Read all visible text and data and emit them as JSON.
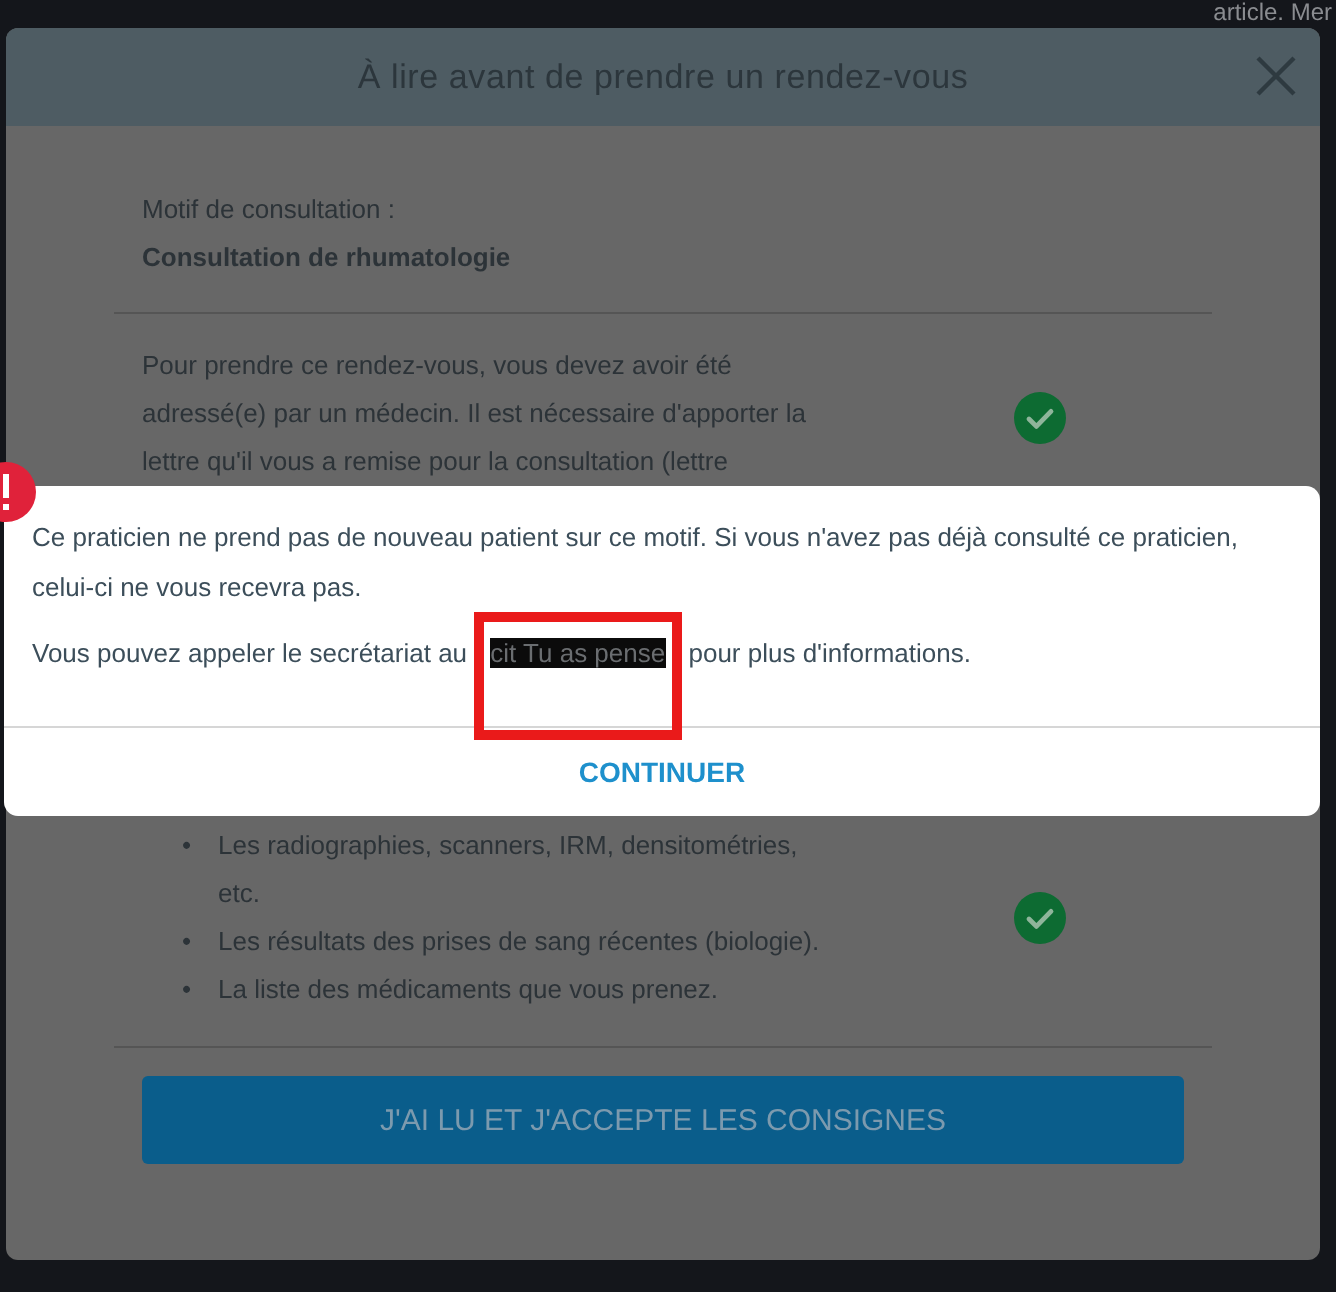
{
  "background": {
    "snippet": "article. Mer"
  },
  "modal": {
    "title": "À lire avant de prendre un rendez-vous",
    "motif_label": "Motif de consultation :",
    "motif": "Consultation de rhumatologie",
    "instructions": [
      {
        "kind": "paragraph",
        "text": "Pour prendre ce rendez-vous, vous devez avoir été adressé(e) par un médecin. Il est nécessaire d'apporter la lettre qu'il vous a remise pour la consultation (lettre",
        "checked": true
      },
      {
        "kind": "list",
        "marker": "•",
        "items": [
          "Les radiographies, scanners, IRM, densitométries, etc.",
          "Les résultats des prises de sang récentes (biologie).",
          "La liste des médicaments que vous prenez."
        ],
        "checked": true
      }
    ],
    "accept_button": "J'AI LU ET J'ACCEPTE LES CONSIGNES"
  },
  "alert": {
    "message": "Ce praticien ne prend pas de nouveau patient sur ce motif. Si vous n'avez pas déjà consulté ce praticien, celui-ci ne vous recevra pas.",
    "phone_prefix": "Vous pouvez appeler le secrétariat au",
    "redacted": "cit Tu as pense",
    "phone_suffix": "pour plus d'informations.",
    "button": "CONTINUER"
  }
}
